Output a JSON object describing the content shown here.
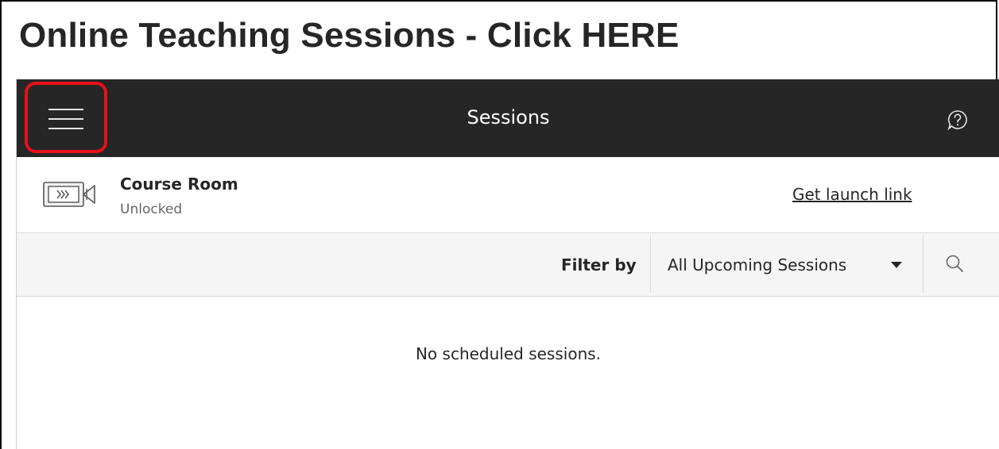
{
  "page": {
    "title": "Online Teaching Sessions - Click HERE"
  },
  "topbar": {
    "title": "Sessions",
    "menu_icon": "hamburger-menu-icon",
    "help_icon": "help-question-icon",
    "background_color": "#262626",
    "highlight_color": "#e8101a"
  },
  "course_room": {
    "icon": "video-camera-icon",
    "name": "Course Room",
    "status": "Unlocked",
    "launch_link_label": "Get launch link"
  },
  "filter": {
    "label": "Filter by",
    "selected": "All Upcoming Sessions",
    "dropdown_icon": "caret-down-icon",
    "search_icon": "search-icon"
  },
  "sessions": {
    "empty_message": "No scheduled sessions."
  }
}
